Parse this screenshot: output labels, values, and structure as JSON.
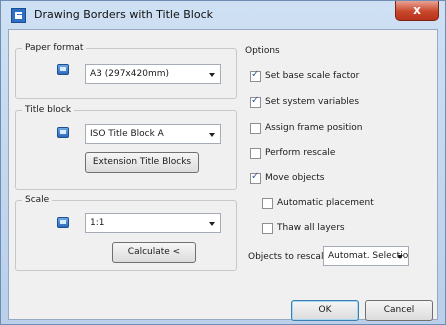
{
  "window": {
    "title": "Drawing Borders with Title Block",
    "close_label": "x"
  },
  "paper_format": {
    "legend": "Paper format",
    "selected": "A3 (297x420mm)"
  },
  "title_block": {
    "legend": "Title block",
    "selected": "ISO Title Block A",
    "extension_button": "Extension Title Blocks"
  },
  "scale": {
    "legend": "Scale",
    "selected": "1:1",
    "calculate_button": "Calculate <"
  },
  "options": {
    "legend": "Options",
    "set_base_scale_factor": {
      "label": "Set base scale factor",
      "checked": true
    },
    "set_system_variables": {
      "label": "Set system variables",
      "checked": true
    },
    "assign_frame_position": {
      "label": "Assign frame position",
      "checked": false
    },
    "perform_rescale": {
      "label": "Perform rescale",
      "checked": false
    },
    "move_objects": {
      "label": "Move objects",
      "checked": true
    },
    "automatic_placement": {
      "label": "Automatic placement",
      "checked": false
    },
    "thaw_all_layers": {
      "label": "Thaw all layers",
      "checked": false
    }
  },
  "objects_to_rescale": {
    "label": "Objects to rescale:",
    "selected": "Automat. Selectio"
  },
  "footer": {
    "ok_label": "OK",
    "cancel_label": "Cancel"
  }
}
